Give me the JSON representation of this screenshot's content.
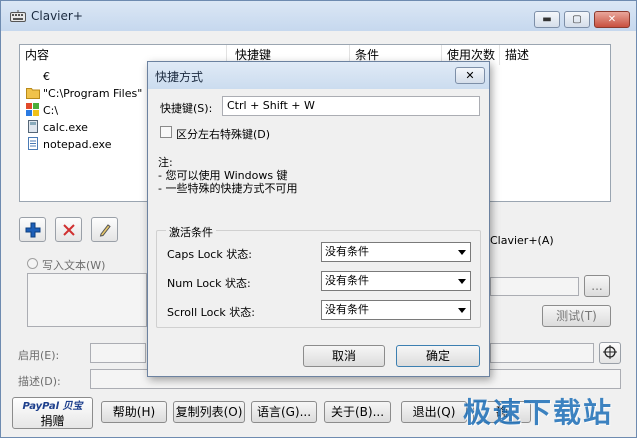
{
  "window": {
    "title": "Clavier+",
    "min_label": "▬",
    "max_label": "▢",
    "close_label": "✕"
  },
  "list": {
    "columns": [
      "内容",
      "快捷键",
      "条件",
      "使用次数",
      "描述"
    ],
    "rows": [
      {
        "content": "€"
      },
      {
        "content": "\"C:\\Program Files\""
      },
      {
        "content": "C:\\"
      },
      {
        "content": "calc.exe"
      },
      {
        "content": "notepad.exe"
      }
    ]
  },
  "toolbar": {
    "add_icon": "plus-icon",
    "delete_icon": "cross-icon",
    "edit_icon": "pencil-icon",
    "hotkey_suffix": "Clavier+(A)"
  },
  "text_section": {
    "write_text_label": "写入文本(W)",
    "test_button": "测试(T)",
    "browse_button": "..."
  },
  "fields": {
    "enable_label": "启用(E):",
    "description_label": "描述(D):"
  },
  "bottom": {
    "paypal_text": "PayPal 贝宝",
    "donate_label": "捐赠",
    "help": "帮助(H)",
    "copy_list": "复制列表(O)",
    "language": "语言(G)...",
    "about": "关于(B)...",
    "exit": "退出(Q)",
    "ok_partial": "确"
  },
  "dialog": {
    "title": "快捷方式",
    "close_label": "✕",
    "hotkey_label": "快捷键(S):",
    "hotkey_value": "Ctrl + Shift + W",
    "distinguish_label": "区分左右特殊键(D)",
    "note_title": "注:",
    "note_line1": "- 您可以使用 Windows 键",
    "note_line2": "- 一些特殊的快捷方式不可用",
    "group_label": "激活条件",
    "caps_label": "Caps Lock 状态:",
    "caps_value": "没有条件",
    "num_label": "Num Lock 状态:",
    "num_value": "没有条件",
    "scroll_label": "Scroll Lock 状态:",
    "scroll_value": "没有条件",
    "cancel": "取消",
    "ok": "确定"
  },
  "watermark": "极速下载站",
  "colors": {
    "accent_blue": "#1d6fb8",
    "delete_red": "#d03030"
  }
}
